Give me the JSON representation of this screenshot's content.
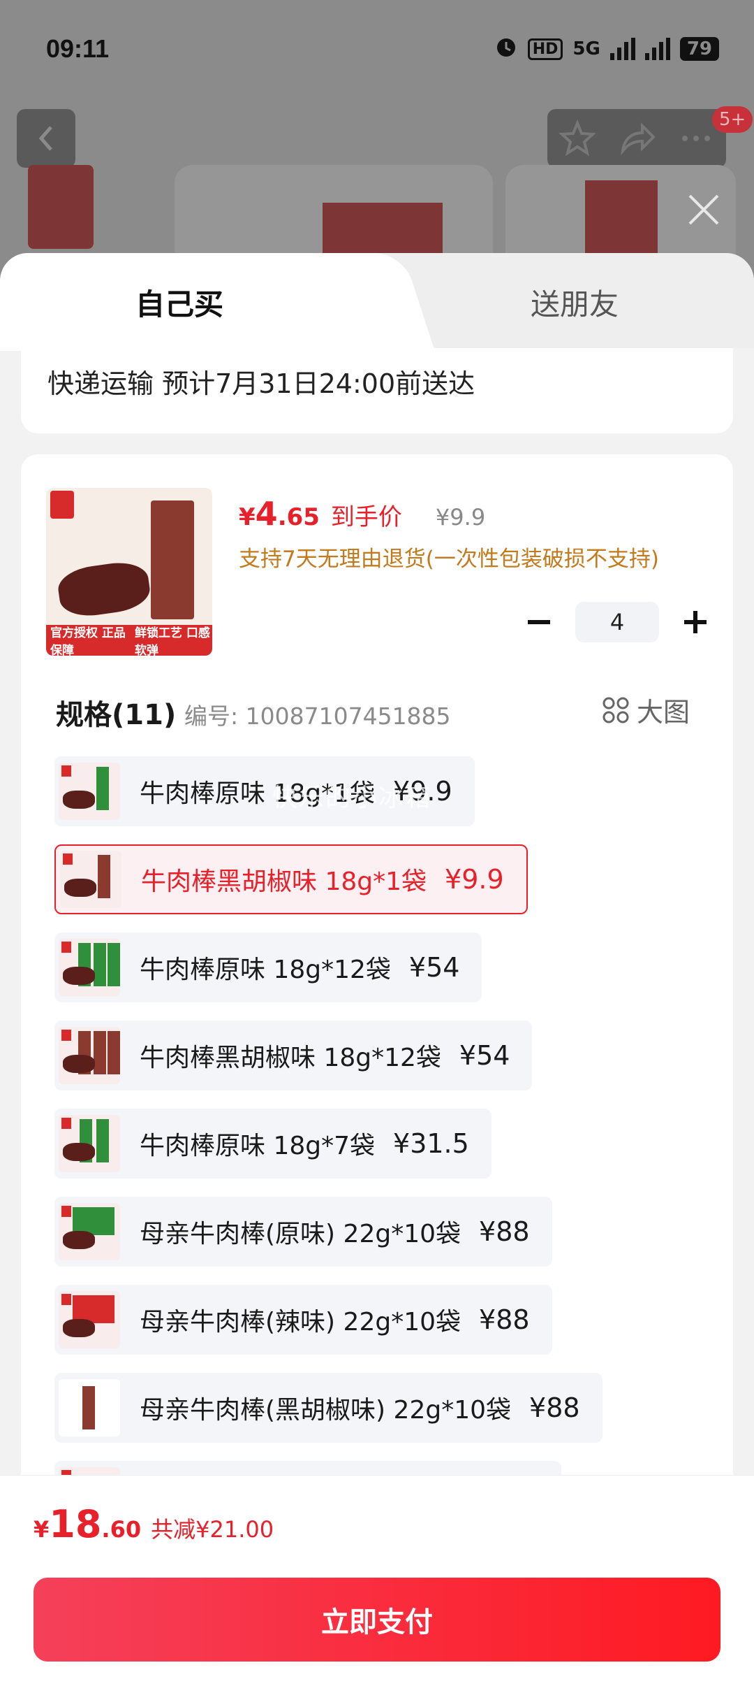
{
  "status_bar": {
    "time": "09:11",
    "network": "5G",
    "hd": "HD",
    "battery": "79"
  },
  "background": {
    "badge": "5+"
  },
  "tabs": [
    {
      "label": "自己买",
      "active": true
    },
    {
      "label": "送朋友",
      "active": false
    }
  ],
  "delivery": {
    "text": "快递运输 预计7月31日24:00前送达"
  },
  "product": {
    "price_currency": "¥",
    "price_int": "4",
    "price_dec": ".65",
    "price_label": "到手价",
    "original_price": "¥9.9",
    "return_policy": "支持7天无理由退货(一次性包装破损不支持)",
    "image_tags": [
      "官方授权 正品保障",
      "鲜锁工艺 口感软弹"
    ],
    "quantity": "4"
  },
  "spec": {
    "title": "规格(11)",
    "code": "编号: 10087107451885",
    "big_image_label": "大图"
  },
  "options": [
    {
      "name": "牛肉棒原味 18g*1袋",
      "price": "¥9.9",
      "selected": false
    },
    {
      "name": "牛肉棒黑胡椒味 18g*1袋",
      "price": "¥9.9",
      "selected": true
    },
    {
      "name": "牛肉棒原味 18g*12袋",
      "price": "¥54",
      "selected": false
    },
    {
      "name": "牛肉棒黑胡椒味 18g*12袋",
      "price": "¥54",
      "selected": false
    },
    {
      "name": "牛肉棒原味 18g*7袋",
      "price": "¥31.5",
      "selected": false
    },
    {
      "name": "母亲牛肉棒(原味) 22g*10袋",
      "price": "¥88",
      "selected": false
    },
    {
      "name": "母亲牛肉棒(辣味) 22g*10袋",
      "price": "¥88",
      "selected": false
    },
    {
      "name": "母亲牛肉棒(黑胡椒味) 22g*10袋",
      "price": "¥88",
      "selected": false
    }
  ],
  "watermark": "快乐的小冰箱",
  "footer": {
    "total_currency": "¥",
    "total_int": "18",
    "total_dec": ".60",
    "discount": "共减¥21.00",
    "pay_label": "立即支付"
  },
  "colors": {
    "accent": "#e8202a",
    "policy": "#c27a1c",
    "pay_button": "#fe1a22"
  }
}
